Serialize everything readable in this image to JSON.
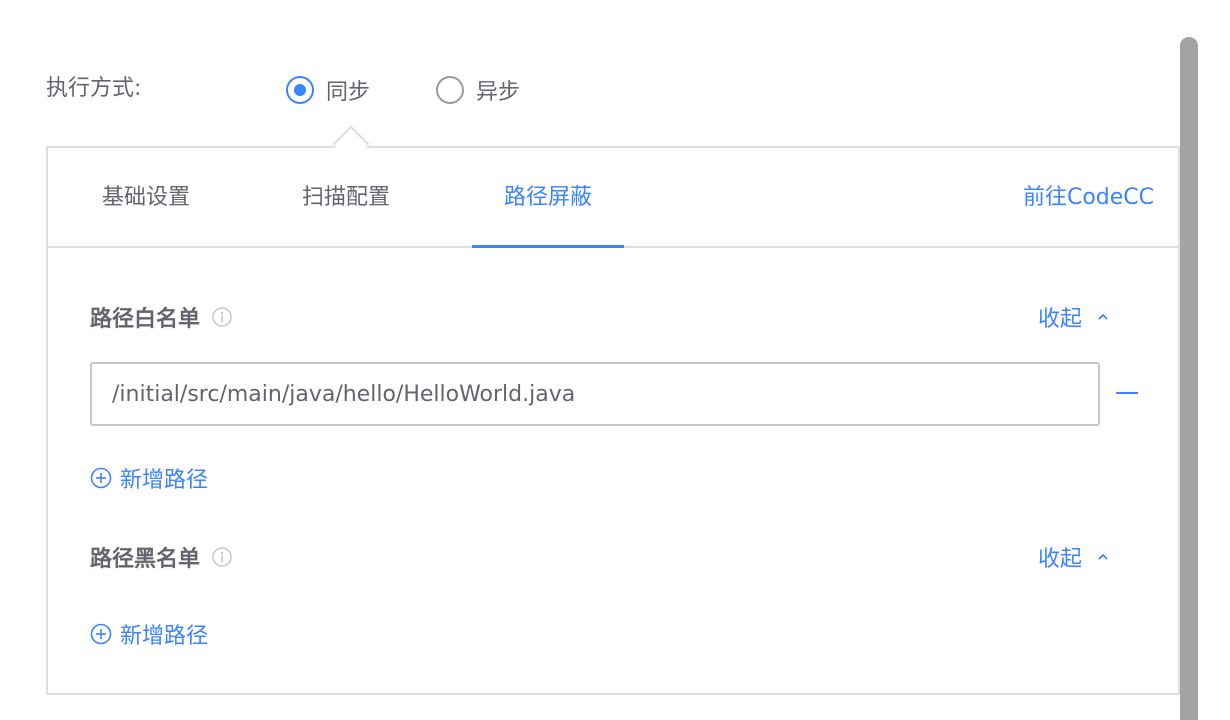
{
  "exec_mode": {
    "label": "执行方式:",
    "options": [
      {
        "label": "同步",
        "checked": true
      },
      {
        "label": "异步",
        "checked": false
      }
    ]
  },
  "tabs": [
    {
      "label": "基础设置",
      "active": false
    },
    {
      "label": "扫描配置",
      "active": false
    },
    {
      "label": "路径屏蔽",
      "active": true
    }
  ],
  "codecc_link": "前往CodeCC",
  "whitelist": {
    "title": "路径白名单",
    "collapse_label": "收起",
    "paths": [
      "/initial/src/main/java/hello/HelloWorld.java"
    ],
    "add_label": "新增路径"
  },
  "blacklist": {
    "title": "路径黑名单",
    "collapse_label": "收起",
    "paths": [],
    "add_label": "新增路径"
  },
  "colors": {
    "accent": "#3a84ff",
    "text": "#63656e",
    "border": "#dcdee5"
  }
}
